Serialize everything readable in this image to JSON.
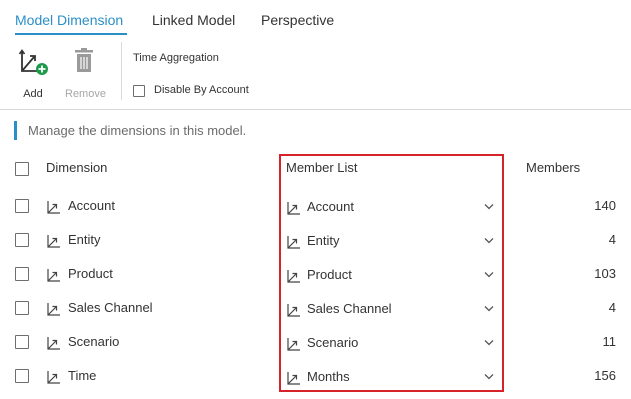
{
  "tabs": [
    {
      "label": "Model Dimension",
      "active": true
    },
    {
      "label": "Linked Model",
      "active": false
    },
    {
      "label": "Perspective",
      "active": false
    }
  ],
  "toolbar": {
    "add_label": "Add",
    "remove_label": "Remove",
    "time_aggregation": "Time Aggregation",
    "disable_by_account": "Disable By Account"
  },
  "hint": "Manage the dimensions in this model.",
  "table": {
    "headers": {
      "dimension": "Dimension",
      "member_list": "Member List",
      "members": "Members"
    },
    "rows": [
      {
        "dimension": "Account",
        "member_list": "Account",
        "members": "140"
      },
      {
        "dimension": "Entity",
        "member_list": "Entity",
        "members": "4"
      },
      {
        "dimension": "Product",
        "member_list": "Product",
        "members": "103"
      },
      {
        "dimension": "Sales Channel",
        "member_list": "Sales Channel",
        "members": "4"
      },
      {
        "dimension": "Scenario",
        "member_list": "Scenario",
        "members": "11"
      },
      {
        "dimension": "Time",
        "member_list": "Months",
        "members": "156"
      }
    ]
  },
  "colors": {
    "accent": "#2b8fc7",
    "highlight": "#d6232a",
    "add_badge": "#1e9a4c"
  }
}
